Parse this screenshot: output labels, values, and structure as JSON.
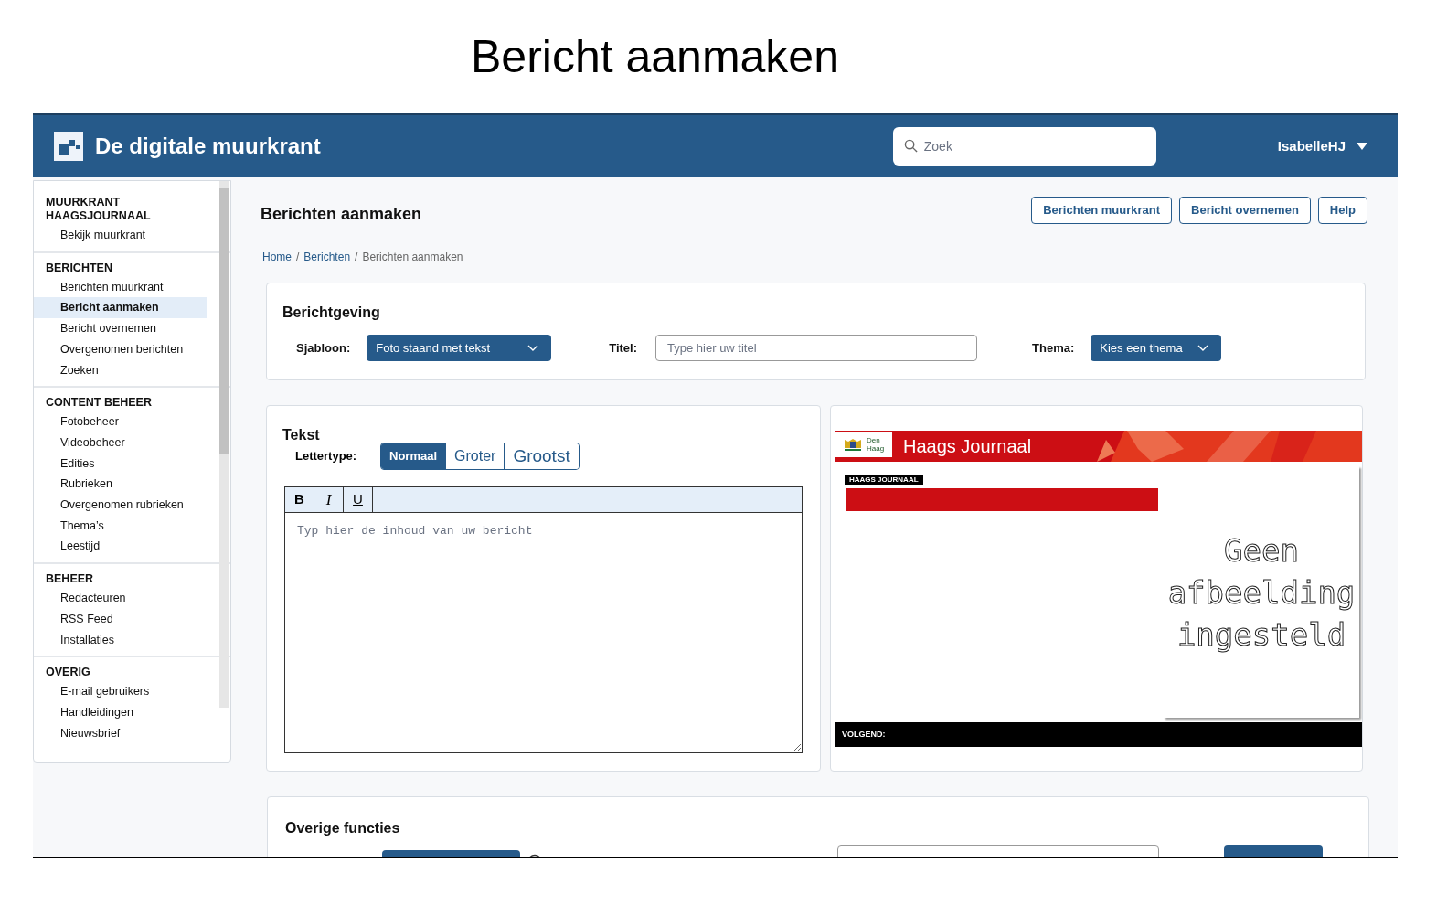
{
  "page_title": "Bericht aanmaken",
  "header": {
    "app_name": "De digitale muurkrant",
    "search": {
      "placeholder": "Zoek"
    },
    "user": "IsabelleHJ"
  },
  "sidebar": {
    "sections": [
      {
        "heading": "MUURKRANT HAAGSJOURNAAL",
        "items": [
          {
            "label": "Bekijk muurkrant",
            "selected": false
          }
        ]
      },
      {
        "heading": "BERICHTEN",
        "items": [
          {
            "label": "Berichten muurkrant",
            "selected": false
          },
          {
            "label": "Bericht aanmaken",
            "selected": true
          },
          {
            "label": "Bericht overnemen",
            "selected": false
          },
          {
            "label": "Overgenomen berichten",
            "selected": false
          },
          {
            "label": "Zoeken",
            "selected": false
          }
        ]
      },
      {
        "heading": "CONTENT BEHEER",
        "items": [
          {
            "label": "Fotobeheer",
            "selected": false
          },
          {
            "label": "Videobeheer",
            "selected": false
          },
          {
            "label": "Edities",
            "selected": false
          },
          {
            "label": "Rubrieken",
            "selected": false
          },
          {
            "label": "Overgenomen rubrieken",
            "selected": false
          },
          {
            "label": "Thema’s",
            "selected": false
          },
          {
            "label": "Leestijd",
            "selected": false
          }
        ]
      },
      {
        "heading": "BEHEER",
        "items": [
          {
            "label": "Redacteuren",
            "selected": false
          },
          {
            "label": "RSS Feed",
            "selected": false
          },
          {
            "label": "Installaties",
            "selected": false
          }
        ]
      },
      {
        "heading": "OVERIG",
        "items": [
          {
            "label": "E-mail gebruikers",
            "selected": false
          },
          {
            "label": "Handleidingen",
            "selected": false
          },
          {
            "label": "Nieuwsbrief",
            "selected": false
          }
        ]
      }
    ]
  },
  "main": {
    "title": "Berichten aanmaken",
    "actions": [
      "Berichten muurkrant",
      "Bericht overnemen",
      "Help"
    ],
    "breadcrumb_separator": "/",
    "breadcrumb": [
      {
        "label": "Home",
        "link": true
      },
      {
        "label": "Berichten",
        "link": true
      },
      {
        "label": "Berichten aanmaken",
        "link": false
      }
    ]
  },
  "berichtgeving": {
    "title": "Berichtgeving",
    "fields": [
      {
        "kind": "dropdown",
        "label": "Sjabloon:",
        "value": "Foto staand met tekst"
      },
      {
        "kind": "text",
        "label": "Titel:",
        "placeholder": "Type hier uw titel"
      },
      {
        "kind": "dropdown",
        "label": "Thema:",
        "value": "Kies een thema"
      }
    ]
  },
  "tekst": {
    "title": "Tekst",
    "font_label": "Lettertype:",
    "font_sizes": [
      {
        "label": "Normaal",
        "selected": true
      },
      {
        "label": "Groter",
        "selected": false
      },
      {
        "label": "Grootst",
        "selected": false
      }
    ],
    "toolbar": [
      {
        "kind": "bold",
        "label": "B"
      },
      {
        "kind": "italic",
        "label": "I"
      },
      {
        "kind": "underline",
        "label": "U"
      }
    ],
    "placeholder": "Typ hier de inhoud van uw bericht"
  },
  "preview": {
    "channel_title": "Haags Journaal",
    "logo_text": "Den Haag",
    "tag": "HAAGS JOURNAAL",
    "image_text": [
      "Geen",
      "afbeelding",
      "ingesteld"
    ],
    "footer": "VOLGEND:"
  },
  "overige": {
    "title": "Overige functies"
  }
}
